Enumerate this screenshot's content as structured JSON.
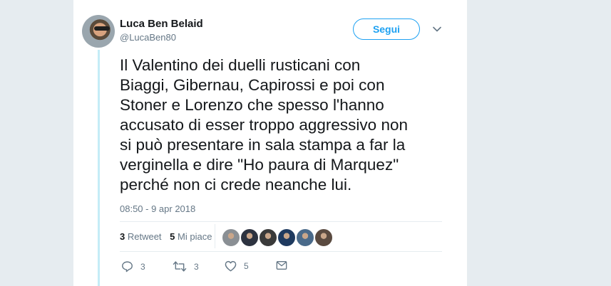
{
  "user": {
    "name": "Luca Ben Belaid",
    "handle": "@LucaBen80"
  },
  "follow_button": {
    "label": "Segui"
  },
  "tweet": {
    "text": "Il Valentino dei duelli rusticani con\nBiaggi, Gibernau, Capirossi e poi con\nStoner e Lorenzo che spesso l'hanno\naccusato di esser troppo aggressivo non\nsi può presentare in sala stampa a far la\nverginella e dire \"Ho paura di Marquez\"\nperché non ci crede neanche lui.",
    "timestamp": "08:50 - 9 apr 2018"
  },
  "stats": {
    "retweet_count": "3",
    "retweet_label": " Retweet",
    "like_count": "5",
    "like_label": " Mi piace"
  },
  "likers": [
    {
      "color": "#8a8f94",
      "icon": "avatar"
    },
    {
      "color": "#2d3340",
      "icon": "avatar"
    },
    {
      "color": "#3a3a3a",
      "icon": "avatar"
    },
    {
      "color": "#1f3a5f",
      "icon": "avatar"
    },
    {
      "color": "#4a6a8a",
      "icon": "avatar"
    },
    {
      "color": "#5a4a40",
      "icon": "avatar"
    }
  ],
  "actions": {
    "reply_count": "3",
    "retweet_count": "3",
    "like_count": "5"
  },
  "colors": {
    "accent": "#1da1f2",
    "thread_line": "#c4ecf7",
    "text": "#14171a",
    "muted": "#657786"
  }
}
